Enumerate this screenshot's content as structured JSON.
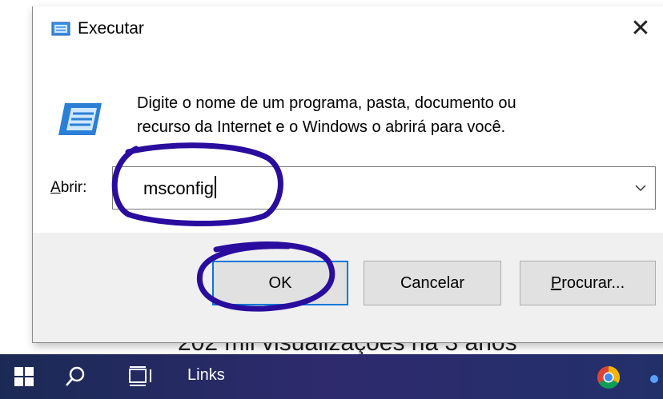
{
  "background": {
    "caption": "202 mil visualizações há 3 anos"
  },
  "dialog": {
    "title": "Executar",
    "close_symbol": "✕",
    "description_line1": "Digite o nome de um programa, pasta, documento ou",
    "description_line2": "recurso da Internet e o Windows o abrirá para você.",
    "open_label_accel": "A",
    "open_label_rest": "brir:",
    "combo_value": "msconfig",
    "buttons": {
      "ok": "OK",
      "cancel": "Cancelar",
      "browse_accel": "P",
      "browse_rest": "rocurar..."
    },
    "icons": [
      "run-icon",
      "close-icon",
      "chevron-down-icon"
    ]
  },
  "annotation": {
    "color": "#2a0d9e",
    "circled": [
      "combo-value",
      "ok-button"
    ]
  },
  "taskbar": {
    "label": "Links",
    "icons": [
      "windows-start-icon",
      "search-icon",
      "task-view-icon",
      "chrome-icon"
    ]
  },
  "colors": {
    "accent": "#0078d7",
    "footer": "#f0f0f0",
    "button": "#e1e1e1"
  }
}
